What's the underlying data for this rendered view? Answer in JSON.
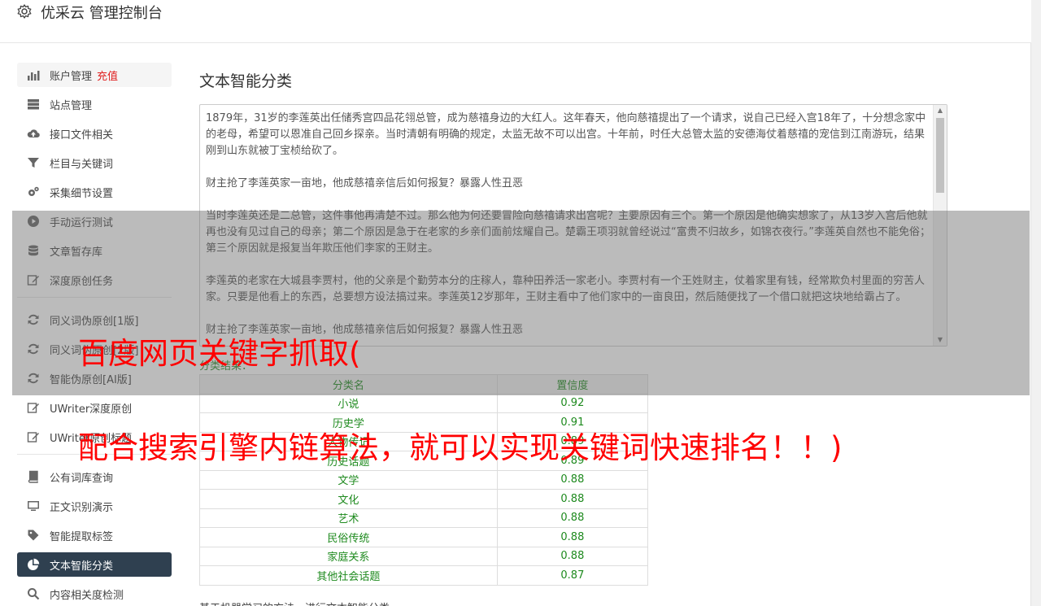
{
  "app": {
    "title": "优采云 管理控制台"
  },
  "sidebar": {
    "groups": [
      [
        {
          "label": "账户管理",
          "badge": "充值",
          "icon": "bar-chart-icon"
        },
        {
          "label": "站点管理",
          "icon": "server-icon"
        },
        {
          "label": "接口文件相关",
          "icon": "cloud-upload-icon"
        },
        {
          "label": "栏目与关键词",
          "icon": "filter-icon"
        },
        {
          "label": "采集细节设置",
          "icon": "cogs-icon"
        },
        {
          "label": "手动运行测试",
          "icon": "play-icon"
        },
        {
          "label": "文章暂存库",
          "icon": "database-icon"
        },
        {
          "label": "深度原创任务",
          "icon": "edit-icon"
        }
      ],
      [
        {
          "label": "同义词伪原创[1版]",
          "icon": "refresh-icon"
        },
        {
          "label": "同义词伪原创[2版]",
          "icon": "refresh-icon"
        },
        {
          "label": "智能伪原创[AI版]",
          "icon": "refresh-icon"
        },
        {
          "label": "UWriter深度原创",
          "icon": "edit-icon"
        },
        {
          "label": "UWriter原创标题",
          "icon": "edit-icon"
        }
      ],
      [
        {
          "label": "公有词库查询",
          "icon": "book-icon"
        },
        {
          "label": "正文识别演示",
          "icon": "monitor-icon"
        },
        {
          "label": "智能提取标签",
          "icon": "tag-icon"
        },
        {
          "label": "文本智能分类",
          "icon": "pie-chart-icon"
        },
        {
          "label": "内容相关度检测",
          "icon": "search-icon"
        }
      ]
    ]
  },
  "main": {
    "title": "文本智能分类",
    "textarea_paragraphs": [
      "1879年，31岁的李莲英出任储秀宫四品花翎总管，成为慈禧身边的大红人。这年春天，他向慈禧提出了一个请求，说自己已经入宫18年了，十分想念家中的老母，希望可以恩准自己回乡探亲。当时清朝有明确的规定，太监无故不可以出宫。十年前，时任大总管太监的安德海仗着慈禧的宠信到江南游玩，结果刚到山东就被丁宝桢给砍了。",
      "财主抢了李莲英家一亩地，他成慈禧亲信后如何报复？暴露人性丑恶",
      "当时李莲英还是二总管，这件事他再清楚不过。那么他为何还要冒险向慈禧请求出宫呢？主要原因有三个。第一个原因是他确实想家了，从13岁入宫后他就再也没有见过自己的母亲；第二个原因是急于在老家的乡亲们面前炫耀自己。楚霸王项羽就曾经说过“富贵不归故乡，如锦衣夜行。”李莲英自然也不能免俗；第三个原因就是报复当年欺压他们李家的王财主。",
      "李莲英的老家在大城县李贾村，他的父亲是个勤劳本分的庄稼人，靠种田养活一家老小。李贾村有一个王姓财主，仗着家里有钱，经常欺负村里面的穷苦人家。只要是他看上的东西，总要想方设法搞过来。李莲英12岁那年，王财主看中了他们家中的一亩良田，然后随便找了一个借口就把这块地给霸占了。",
      "财主抢了李莲英家一亩地，他成慈禧亲信后如何报复？暴露人性丑恶"
    ],
    "result_label": "分类结果：",
    "table": {
      "headers": [
        "分类名",
        "置信度"
      ],
      "rows": [
        [
          "小说",
          "0.92"
        ],
        [
          "历史学",
          "0.91"
        ],
        [
          "人物传记",
          "0.89"
        ],
        [
          "历史话题",
          "0.89"
        ],
        [
          "文学",
          "0.88"
        ],
        [
          "文化",
          "0.88"
        ],
        [
          "艺术",
          "0.88"
        ],
        [
          "民俗传统",
          "0.88"
        ],
        [
          "家庭关系",
          "0.88"
        ],
        [
          "其他社会话题",
          "0.87"
        ]
      ]
    },
    "footnote": "基于机器学习的方法，进行文本智能分类。"
  },
  "overlay": {
    "line1": "百度网页关键字抓取(",
    "line2": "配合搜索引擎内链算法，就可以实现关键词快速排名！！)"
  },
  "colors": {
    "accent": "#2f4050",
    "result_green": "#1e8a1e",
    "banner_red": "#ff0000",
    "badge_red": "#e02020"
  }
}
